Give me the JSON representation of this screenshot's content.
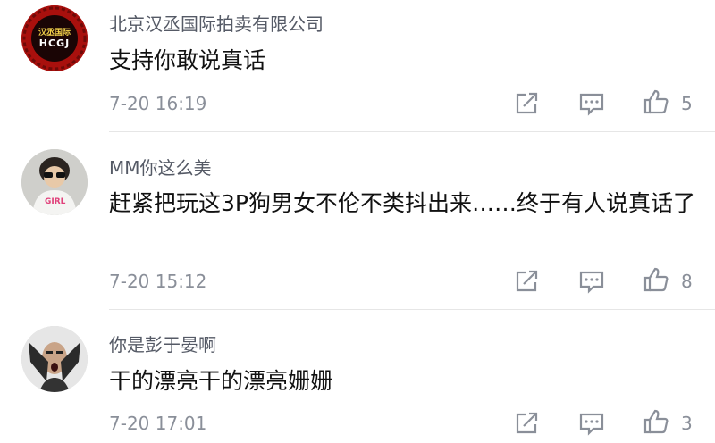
{
  "comments": [
    {
      "user": "北京汉丞国际拍卖有限公司",
      "avatar_text_top": "汉丞国际",
      "avatar_text_bottom": "HCGJ",
      "text": "支持你敢说真话",
      "time": "7-20 16:19",
      "likes": "5"
    },
    {
      "user": "MM你这么美",
      "avatar_shirt_text": "GIRL",
      "text": "赶紧把玩这3P狗男女不伦不类抖出来……终于有人说真话了",
      "time": "7-20 15:12",
      "likes": "8"
    },
    {
      "user": "你是彭于晏啊",
      "text": "干的漂亮干的漂亮姗姗",
      "time": "7-20 17:01",
      "likes": "3"
    }
  ],
  "icons": {
    "share": "share-icon",
    "reply": "comment-icon",
    "like": "thumbs-up-icon"
  },
  "colors": {
    "avatar1_bg": "#b3120f",
    "avatar1_text": "#f2d04a",
    "meta_gray": "#8a8f99"
  }
}
